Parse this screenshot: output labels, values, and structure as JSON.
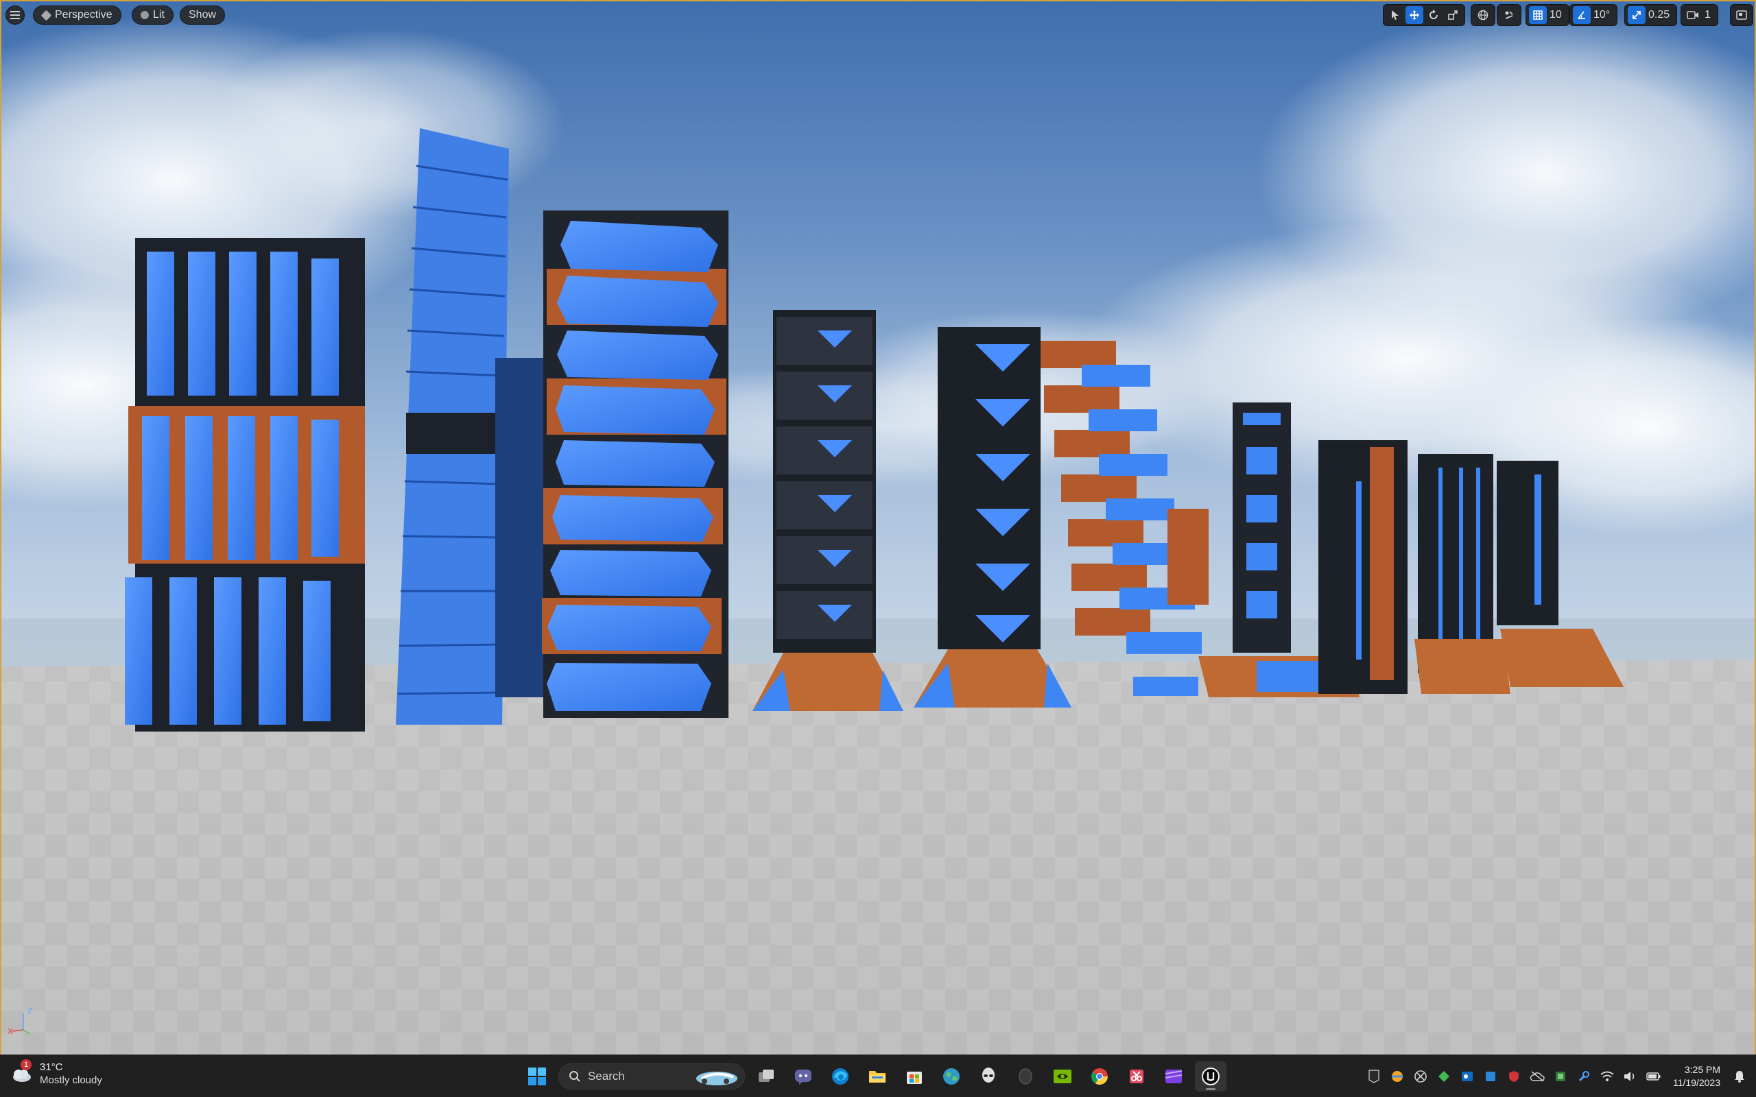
{
  "viewport": {
    "view_mode": "Perspective",
    "lighting_mode": "Lit",
    "show_label": "Show",
    "grid_snap_value": "10",
    "rotation_snap_value": "10°",
    "scale_snap_value": "0.25",
    "camera_speed_value": "1",
    "axis": {
      "x": "x",
      "z": "z"
    }
  },
  "taskbar": {
    "weather": {
      "temperature": "31°C",
      "condition": "Mostly cloudy",
      "badge": "1"
    },
    "search_placeholder": "Search",
    "clock": {
      "time": "3:25 PM",
      "date": "11/19/2023"
    },
    "pinned_apps": [
      "start",
      "task-view",
      "teams-chat",
      "edge",
      "file-explorer",
      "microsoft-store",
      "browser-globe",
      "alienware",
      "app-dark",
      "nvidia",
      "chrome",
      "snipping-tool",
      "clipchamp",
      "unreal-engine"
    ],
    "tray": [
      "epic-games",
      "app-ball",
      "xbox",
      "app-green",
      "outlook",
      "app-blue-sq",
      "app-red-shield",
      "onedrive",
      "app-green-sq",
      "app-wrench",
      "wifi",
      "volume",
      "battery"
    ]
  },
  "colors": {
    "viewport_border": "#d6a23a",
    "accent": "#1e6fd8",
    "building_glow": "#3f86f5",
    "building_frame": "#1f242d",
    "building_copper": "#b45a2c"
  }
}
